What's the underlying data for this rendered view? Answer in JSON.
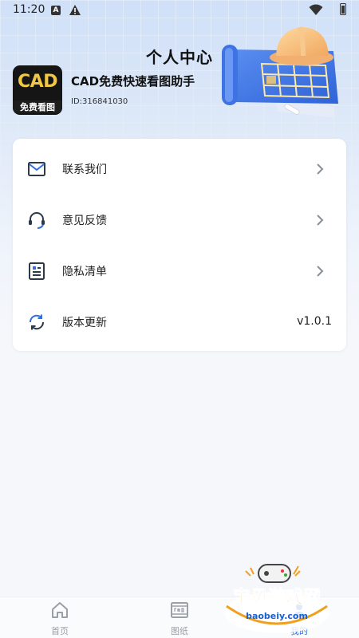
{
  "status_bar": {
    "time": "11:20",
    "notification_icons": [
      "a-icon",
      "warning-icon"
    ],
    "right_icons": [
      "wifi-icon",
      "battery-icon"
    ]
  },
  "header": {
    "title": "个人中心"
  },
  "app": {
    "logo_text": "CAD",
    "logo_subtext": "免费看图",
    "name": "CAD免费快速看图助手",
    "id_text": "ID:316841030"
  },
  "menu": {
    "items": [
      {
        "label": "联系我们",
        "icon": "mail-icon",
        "trailing": "chevron"
      },
      {
        "label": "意见反馈",
        "icon": "headset-icon",
        "trailing": "chevron"
      },
      {
        "label": "隐私清单",
        "icon": "document-list-icon",
        "trailing": "chevron"
      },
      {
        "label": "版本更新",
        "icon": "refresh-icon",
        "trailing": "version",
        "value": "v1.0.1"
      }
    ]
  },
  "tabbar": {
    "tabs": [
      {
        "label": "首页",
        "icon": "home-icon",
        "active": false
      },
      {
        "label": "图纸",
        "icon": "cad-drawing-icon",
        "active": false
      },
      {
        "label": "我的",
        "icon": "profile-icon",
        "active": true
      }
    ]
  },
  "watermark": {
    "text": "宝贝游戏网",
    "url_text": "baobeiy.com"
  },
  "colors": {
    "accent": "#2f6fe0",
    "header_gradient_top": "#cfe0f8",
    "logo_gold": "#f2c744",
    "icon_dark": "#2a3a4a",
    "watermark_orange": "#f0a020"
  }
}
